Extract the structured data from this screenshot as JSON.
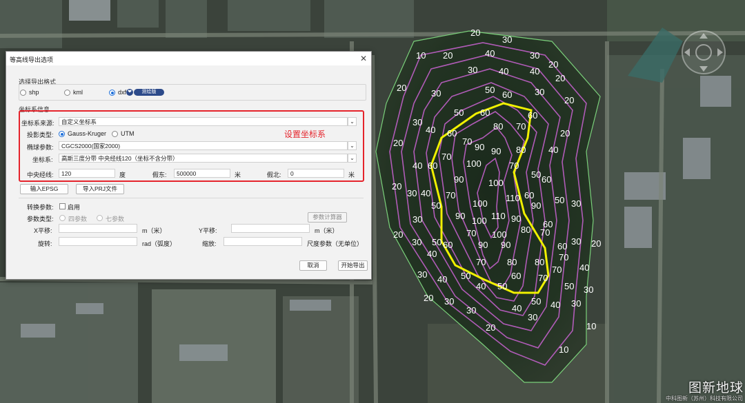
{
  "dialog": {
    "title": "等高线导出选项",
    "close_glyph": "✕",
    "format_section": {
      "title": "选择导出格式",
      "options": [
        "shp",
        "kml",
        "dxf"
      ],
      "selected": "dxf",
      "badge_glyph": "❤",
      "badge": "测绘版"
    },
    "crs_section": {
      "title": "坐标系信息",
      "source_label": "坐标系来源:",
      "source_value": "自定义坐标系",
      "projection_label": "投影类型:",
      "projection_options": [
        "Gauss-Kruger",
        "UTM"
      ],
      "projection_selected": "Gauss-Kruger",
      "ellipsoid_label": "椭球参数:",
      "ellipsoid_value": "CGCS2000(国家2000)",
      "crs_label": "坐标系:",
      "crs_value": "高斯三度分带 中央经线120（坐标不含分带）",
      "central_meridian_label": "中央经线:",
      "central_meridian_value": "120",
      "central_meridian_unit": "度",
      "false_easting_label": "假东:",
      "false_easting_value": "500000",
      "false_easting_unit": "米",
      "false_northing_label": "假北:",
      "false_northing_value": "0",
      "false_northing_unit": "米",
      "combo_glyph": "⌄"
    },
    "annotation": "设置坐标系",
    "buttons": {
      "epsg": "输入EPSG",
      "prj": "导入PRJ文件",
      "calc": "参数计算器",
      "cancel": "取消",
      "export": "开始导出"
    },
    "transform_section": {
      "transform_label": "转换参数:",
      "enable_label": "启用",
      "param_type_label": "参数类型:",
      "param_options": [
        "四参数",
        "七参数"
      ],
      "x_label": "X平移:",
      "x_unit": "m（米）",
      "y_label": "Y平移:",
      "y_unit": "m（米）",
      "rotate_label": "旋转:",
      "rotate_unit": "rad（弧度）",
      "scale_label": "缩放:",
      "scale_unit": "尺度参数（无单位）"
    }
  },
  "map": {
    "contour_labels": [
      "10",
      "20",
      "30",
      "40",
      "50",
      "60",
      "70",
      "80",
      "90",
      "100",
      "110"
    ],
    "brand": "图新地球",
    "brand_sub": "中科图新（苏州）科技有限公司"
  },
  "colors": {
    "contour": "#c060c8",
    "highlight": "#f0f000",
    "boundary": "#7ad07a",
    "annotation": "#e5232b"
  }
}
